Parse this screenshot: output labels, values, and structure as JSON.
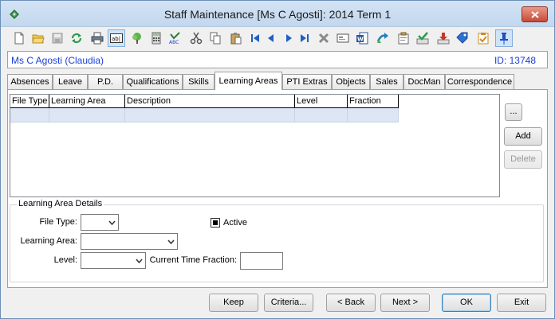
{
  "window": {
    "title": "Staff Maintenance  [Ms C Agosti]:  2014 Term 1"
  },
  "toolbar": {
    "buttons": [
      {
        "icon": "new-document-icon"
      },
      {
        "icon": "open-folder-icon"
      },
      {
        "icon": "save-disk-icon"
      },
      {
        "icon": "refresh-icon"
      },
      {
        "icon": "print-icon"
      },
      {
        "icon": "text-field-icon",
        "pressed": true
      },
      {
        "icon": "tree-icon"
      },
      {
        "icon": "calculator-icon"
      },
      {
        "icon": "spell-check-icon"
      },
      {
        "icon": "cut-icon"
      },
      {
        "icon": "copy-icon"
      },
      {
        "icon": "paste-icon"
      },
      {
        "icon": "first-record-icon"
      },
      {
        "icon": "previous-record-icon"
      },
      {
        "icon": "next-record-icon"
      },
      {
        "icon": "last-record-icon"
      },
      {
        "icon": "delete-x-icon"
      },
      {
        "icon": "card-icon"
      },
      {
        "icon": "word-document-icon"
      },
      {
        "icon": "send-arrow-icon"
      },
      {
        "icon": "clipboard-icon"
      },
      {
        "icon": "approve-stamp-icon"
      },
      {
        "icon": "download-tray-icon"
      },
      {
        "icon": "tag-icon"
      },
      {
        "icon": "checklist-icon"
      },
      {
        "icon": "pin-icon",
        "pressed": true
      }
    ]
  },
  "staff": {
    "name": "Ms C Agosti (Claudia)",
    "id_text": "ID: 13748"
  },
  "tabs": [
    {
      "label": "Absences"
    },
    {
      "label": "Leave"
    },
    {
      "label": "P.D."
    },
    {
      "label": "Qualifications"
    },
    {
      "label": "Skills"
    },
    {
      "label": "Learning Areas",
      "active": true
    },
    {
      "label": "PTI Extras"
    },
    {
      "label": "Objects"
    },
    {
      "label": "Sales"
    },
    {
      "label": "DocMan"
    },
    {
      "label": "Correspondence"
    }
  ],
  "grid": {
    "columns": [
      "File Type",
      "Learning Area",
      "Description",
      "Level",
      "Fraction"
    ]
  },
  "side_buttons": {
    "more_label": "...",
    "add_label": "Add",
    "delete_label": "Delete"
  },
  "details": {
    "group_title": "Learning Area Details",
    "file_type_label": "File Type:",
    "file_type_value": "",
    "active_label": "Active",
    "active_checked": true,
    "learning_area_label": "Learning Area:",
    "learning_area_value": "",
    "level_label": "Level:",
    "level_value": "",
    "time_fraction_label": "Current Time Fraction:",
    "time_fraction_value": ""
  },
  "footer": {
    "keep_label": "Keep",
    "criteria_label": "Criteria...",
    "back_label": "< Back",
    "next_label": "Next >",
    "ok_label": "OK",
    "exit_label": "Exit"
  }
}
